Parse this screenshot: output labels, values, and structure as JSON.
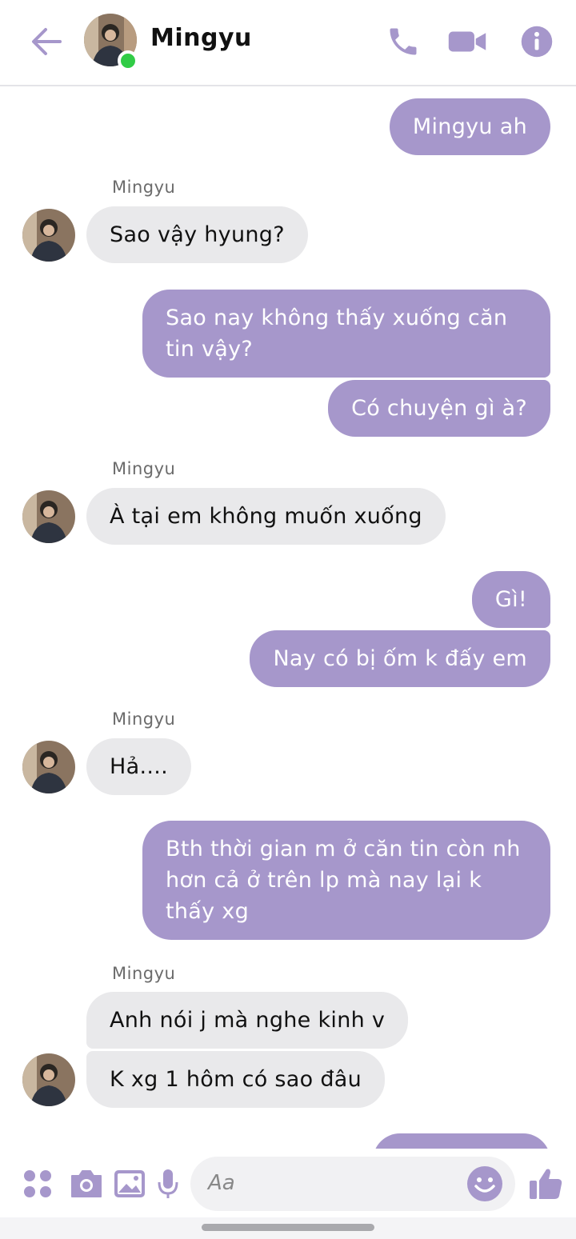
{
  "header": {
    "contact_name": "Mingyu",
    "online": true
  },
  "colors": {
    "accent": "#a697cb",
    "incoming_bubble": "#e9e9eb",
    "online": "#31cc46"
  },
  "messages": [
    {
      "direction": "out",
      "text": "Mingyu ah"
    },
    {
      "direction": "in",
      "sender": "Mingyu",
      "text": "Sao vậy hyung?"
    },
    {
      "direction": "out",
      "text": "Sao nay không thấy xuống căn tin vậy?"
    },
    {
      "direction": "out",
      "text": "Có chuyện gì à?"
    },
    {
      "direction": "in",
      "sender": "Mingyu",
      "text": "À tại em không muốn xuống"
    },
    {
      "direction": "out",
      "text": "Gì!"
    },
    {
      "direction": "out",
      "text": "Nay có bị ốm k đấy em"
    },
    {
      "direction": "in",
      "sender": "Mingyu",
      "text": "Hả...."
    },
    {
      "direction": "out",
      "text": "Bth thời gian m ở căn tin còn nh hơn cả ở trên lp mà nay lại k thấy xg"
    },
    {
      "direction": "in",
      "sender": "Mingyu",
      "text": "Anh nói j mà nghe kinh v"
    },
    {
      "direction": "in",
      "text": "K xg 1 hôm có sao đâu"
    }
  ],
  "composer": {
    "placeholder": "Aa",
    "icons": [
      "apps-icon",
      "camera-icon",
      "image-icon",
      "microphone-icon",
      "emoji-icon",
      "thumbs-up-icon"
    ]
  }
}
